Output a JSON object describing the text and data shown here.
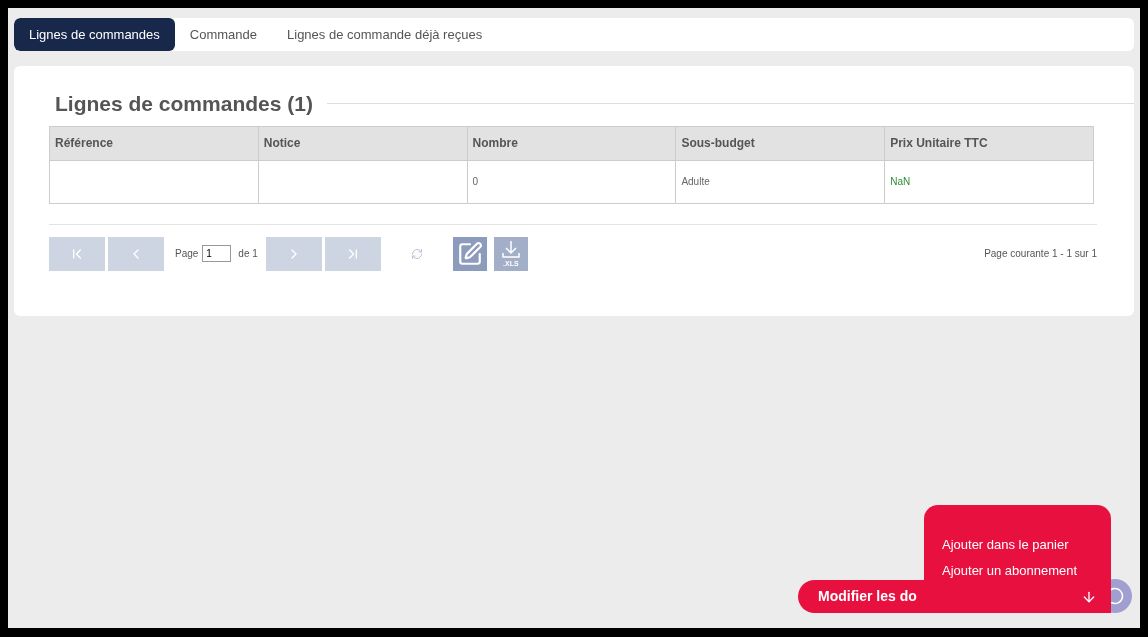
{
  "tabs": [
    {
      "label": "Lignes de commandes",
      "selected": true
    },
    {
      "label": "Commande",
      "selected": false
    },
    {
      "label": "Lignes de commande déjà reçues",
      "selected": false
    }
  ],
  "panel": {
    "title": "Lignes de commandes (1)"
  },
  "table": {
    "columns": [
      {
        "label": "Référence",
        "kind": "text"
      },
      {
        "label": "Notice",
        "kind": "text"
      },
      {
        "label": "Nombre",
        "kind": "text"
      },
      {
        "label": "Sous-budget",
        "kind": "text"
      },
      {
        "label": "Prix Unitaire TTC",
        "kind": "price"
      }
    ],
    "rows": [
      [
        "",
        "",
        "0",
        "Adulte",
        "NaN"
      ]
    ]
  },
  "pager": {
    "page_label": "Page",
    "page_value": "1",
    "of_label": "de 1",
    "summary": "Page courante 1 - 1 sur 1",
    "export_label": ".XLS"
  },
  "action_menu": {
    "button": "Modifier les do",
    "items": [
      "Ajouter dans le panier",
      "Ajouter un abonnement"
    ]
  }
}
